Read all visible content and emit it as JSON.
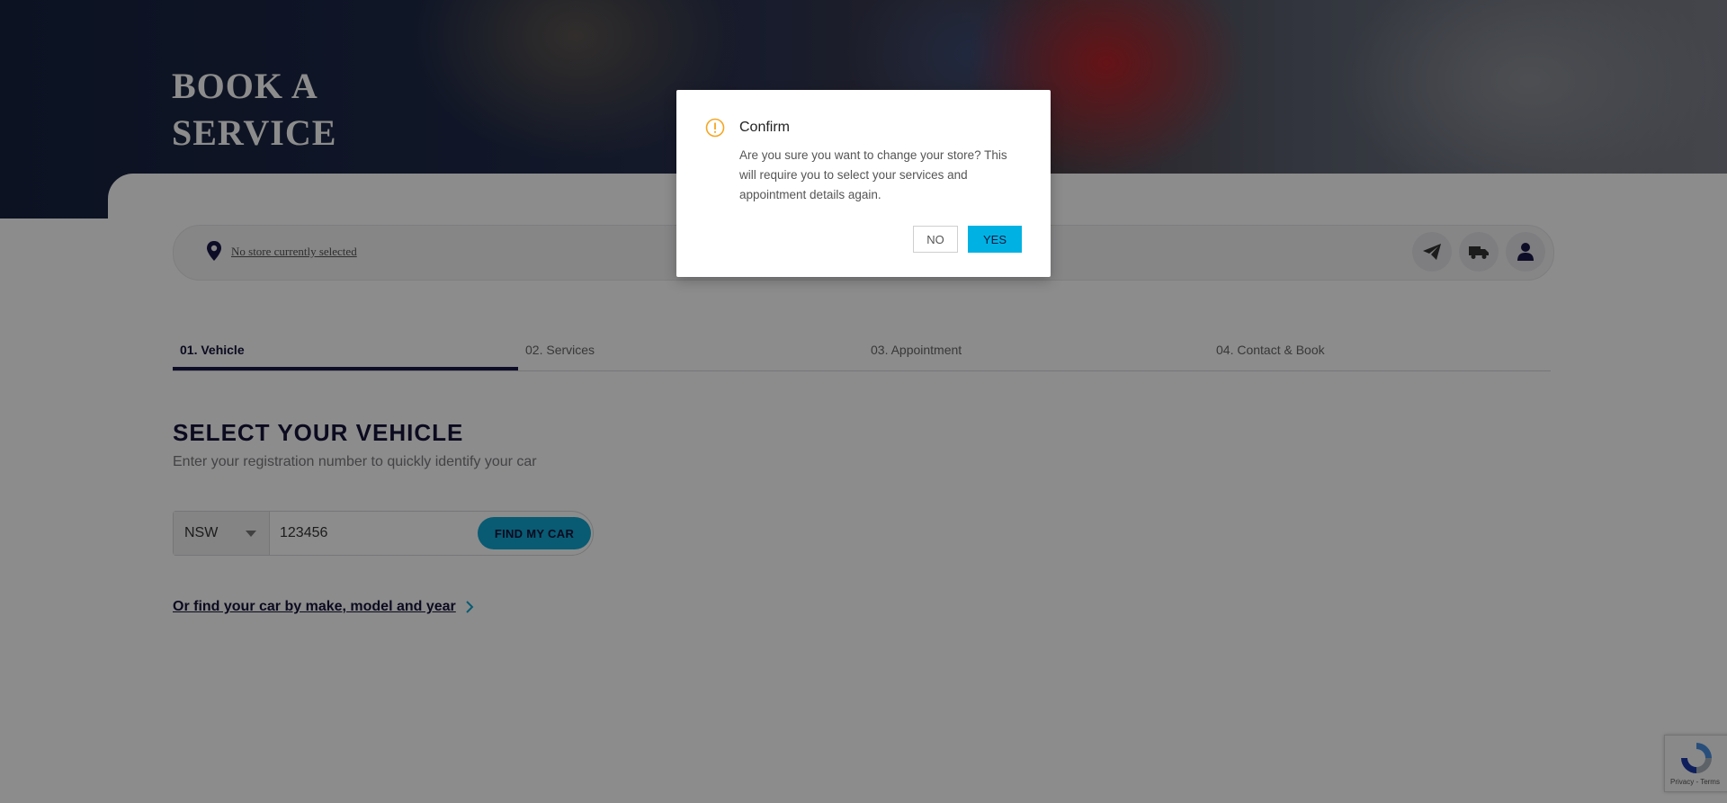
{
  "hero": {
    "title": "BOOK A SERVICE"
  },
  "store_bar": {
    "store_link": "No store currently selected",
    "icons": [
      "location-pin-icon",
      "paper-plane-icon",
      "truck-icon",
      "user-icon"
    ]
  },
  "steps": [
    {
      "label": "01. Vehicle",
      "active": true
    },
    {
      "label": "02. Services",
      "active": false
    },
    {
      "label": "03. Appointment",
      "active": false
    },
    {
      "label": "04. Contact & Book",
      "active": false
    }
  ],
  "vehicle": {
    "title": "SELECT YOUR VEHICLE",
    "subtitle": "Enter your registration number to quickly identify your car",
    "state_value": "NSW",
    "rego_value": "123456",
    "find_button": "FIND MY CAR",
    "make_model_link": "Or find your car by make, model and year"
  },
  "modal": {
    "title": "Confirm",
    "message": "Are you sure you want to change your store? This will require you to select your services and appointment details again.",
    "no_label": "NO",
    "yes_label": "YES"
  },
  "recaptcha": {
    "text": "Privacy - Terms"
  },
  "colors": {
    "navy": "#15133a",
    "accent_cyan": "#10a6d1",
    "modal_yes": "#00b2e3",
    "warning": "#f5a623"
  }
}
